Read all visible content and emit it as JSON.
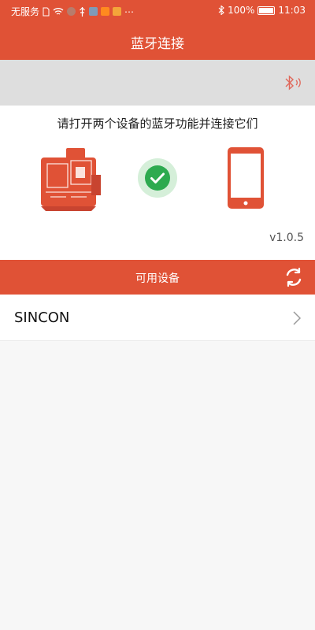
{
  "status_bar": {
    "carrier": "无服务",
    "battery_percent": "100%",
    "battery_level": 1.0,
    "time": "11:03",
    "icons": [
      "sim-icon",
      "wifi-icon",
      "avatar-icon",
      "usb-icon",
      "app-icon",
      "video-icon",
      "notification-icon",
      "more-icon",
      "bluetooth-icon",
      "battery-icon"
    ]
  },
  "header": {
    "title": "蓝牙连接"
  },
  "toolbar": {
    "bluetooth_icon": "bluetooth-signal-icon"
  },
  "connection": {
    "instruction": "请打开两个设备的蓝牙功能并连接它们",
    "left_device": "laser-level-device-icon",
    "status_icon": "check-circle-icon",
    "right_device": "smartphone-icon",
    "version": "v1.0.5"
  },
  "available": {
    "title": "可用设备",
    "refresh_icon": "refresh-icon",
    "devices": [
      {
        "label": "SINCON"
      }
    ]
  },
  "colors": {
    "accent": "#e05236",
    "toolbar_bg": "#dedede",
    "panel_bg": "#ffffff",
    "page_bg": "#f7f7f7",
    "check_green": "#2daa4f",
    "check_halo": "#d5efd9"
  }
}
